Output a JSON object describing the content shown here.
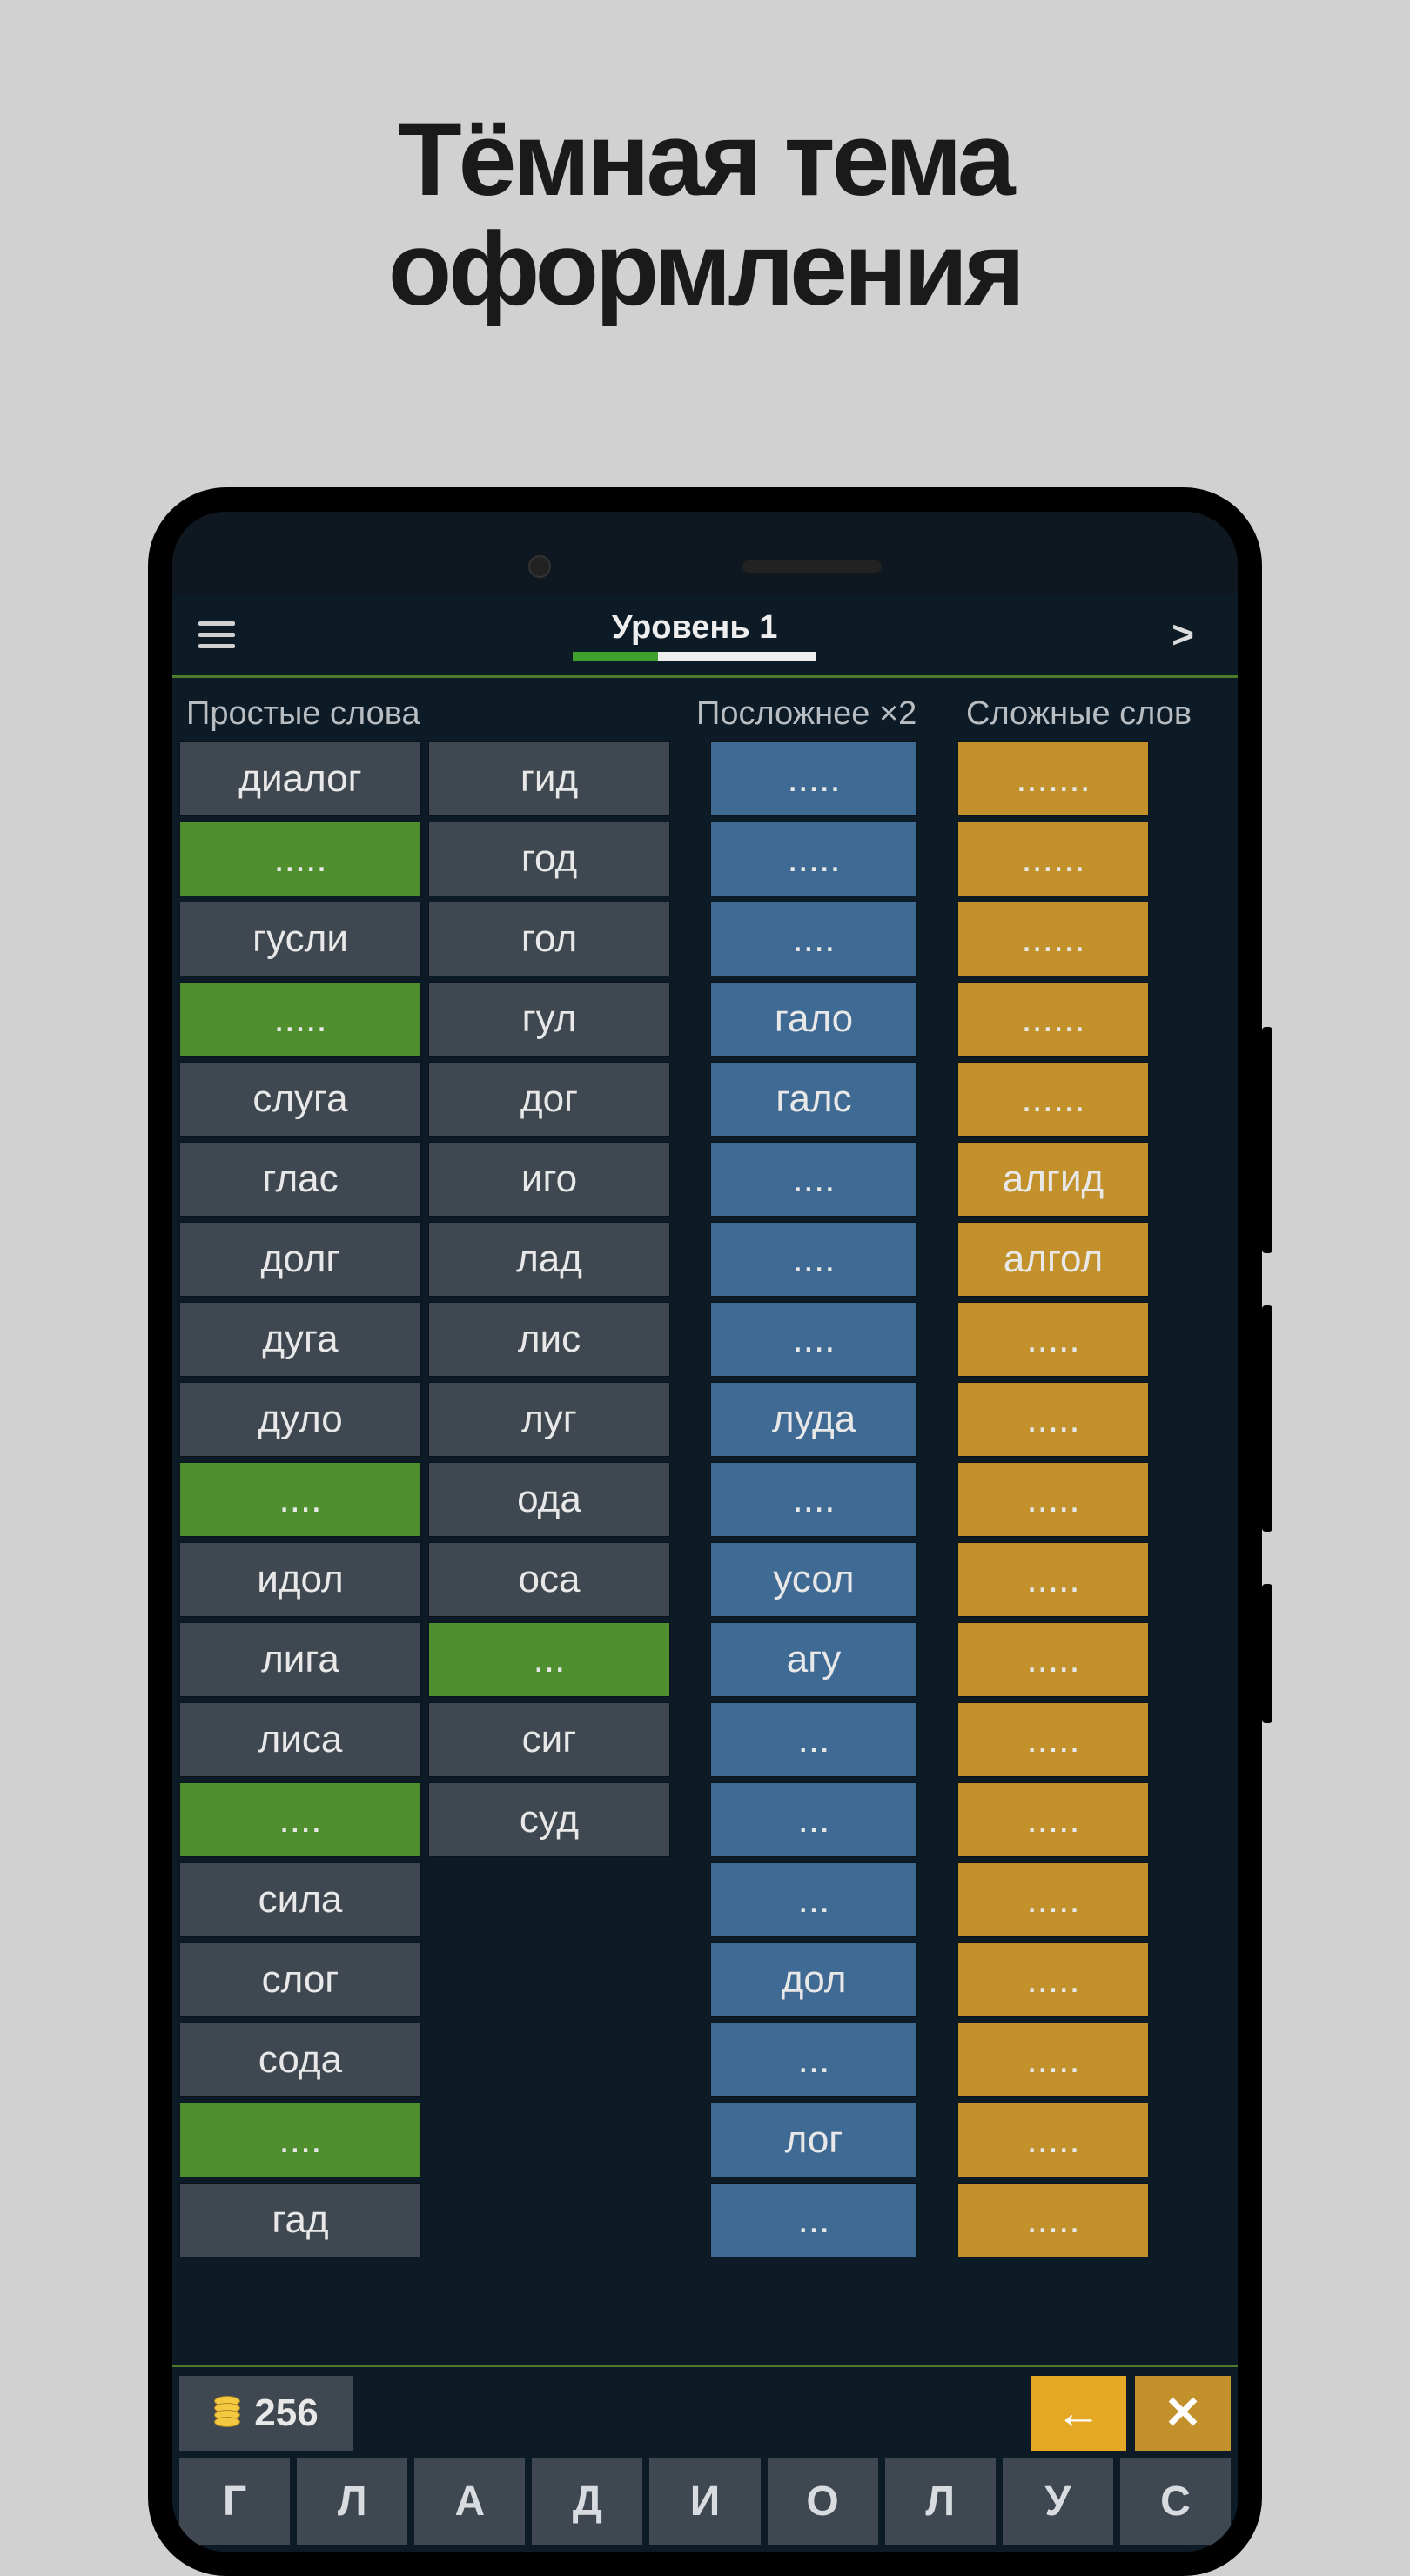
{
  "page_title_line1": "Тёмная тема",
  "page_title_line2": "оформления",
  "topbar": {
    "level_label": "Уровень 1",
    "progress_percent": 35
  },
  "columns": {
    "header_simple": "Простые слова",
    "header_medium": "Посложнее ×2",
    "header_hard": "Сложные слов",
    "left": [
      {
        "text": "диалог",
        "style": "gray"
      },
      {
        "text": ".....",
        "style": "green"
      },
      {
        "text": "гусли",
        "style": "gray"
      },
      {
        "text": ".....",
        "style": "green"
      },
      {
        "text": "слуга",
        "style": "gray"
      },
      {
        "text": "глас",
        "style": "gray"
      },
      {
        "text": "долг",
        "style": "gray"
      },
      {
        "text": "дуга",
        "style": "gray"
      },
      {
        "text": "дуло",
        "style": "gray"
      },
      {
        "text": "....",
        "style": "green"
      },
      {
        "text": "идол",
        "style": "gray"
      },
      {
        "text": "лига",
        "style": "gray"
      },
      {
        "text": "лиса",
        "style": "gray"
      },
      {
        "text": "....",
        "style": "green"
      },
      {
        "text": "сила",
        "style": "gray"
      },
      {
        "text": "слог",
        "style": "gray"
      },
      {
        "text": "сода",
        "style": "gray"
      },
      {
        "text": "....",
        "style": "green"
      },
      {
        "text": "гад",
        "style": "gray"
      }
    ],
    "mid": [
      {
        "text": "гид",
        "style": "gray"
      },
      {
        "text": "год",
        "style": "gray"
      },
      {
        "text": "гол",
        "style": "gray"
      },
      {
        "text": "гул",
        "style": "gray"
      },
      {
        "text": "дог",
        "style": "gray"
      },
      {
        "text": "иго",
        "style": "gray"
      },
      {
        "text": "лад",
        "style": "gray"
      },
      {
        "text": "лис",
        "style": "gray"
      },
      {
        "text": "луг",
        "style": "gray"
      },
      {
        "text": "ода",
        "style": "gray"
      },
      {
        "text": "оса",
        "style": "gray"
      },
      {
        "text": "...",
        "style": "green"
      },
      {
        "text": "сиг",
        "style": "gray"
      },
      {
        "text": "суд",
        "style": "gray"
      }
    ],
    "blue": [
      {
        "text": ".....",
        "style": "blue"
      },
      {
        "text": ".....",
        "style": "blue"
      },
      {
        "text": "....",
        "style": "blue"
      },
      {
        "text": "гало",
        "style": "blue"
      },
      {
        "text": "галс",
        "style": "blue"
      },
      {
        "text": "....",
        "style": "blue"
      },
      {
        "text": "....",
        "style": "blue"
      },
      {
        "text": "....",
        "style": "blue"
      },
      {
        "text": "луда",
        "style": "blue"
      },
      {
        "text": "....",
        "style": "blue"
      },
      {
        "text": "усол",
        "style": "blue"
      },
      {
        "text": "агу",
        "style": "blue"
      },
      {
        "text": "...",
        "style": "blue"
      },
      {
        "text": "...",
        "style": "blue"
      },
      {
        "text": "...",
        "style": "blue"
      },
      {
        "text": "дол",
        "style": "blue"
      },
      {
        "text": "...",
        "style": "blue"
      },
      {
        "text": "лог",
        "style": "blue"
      },
      {
        "text": "...",
        "style": "blue"
      }
    ],
    "orange": [
      {
        "text": ".......",
        "style": "orange"
      },
      {
        "text": "......",
        "style": "orange"
      },
      {
        "text": "......",
        "style": "orange"
      },
      {
        "text": "......",
        "style": "orange"
      },
      {
        "text": "......",
        "style": "orange"
      },
      {
        "text": "алгид",
        "style": "orange"
      },
      {
        "text": "алгол",
        "style": "orange"
      },
      {
        "text": ".....",
        "style": "orange"
      },
      {
        "text": ".....",
        "style": "orange"
      },
      {
        "text": ".....",
        "style": "orange"
      },
      {
        "text": ".....",
        "style": "orange"
      },
      {
        "text": ".....",
        "style": "orange"
      },
      {
        "text": ".....",
        "style": "orange"
      },
      {
        "text": ".....",
        "style": "orange"
      },
      {
        "text": ".....",
        "style": "orange"
      },
      {
        "text": ".....",
        "style": "orange"
      },
      {
        "text": ".....",
        "style": "orange"
      },
      {
        "text": ".....",
        "style": "orange"
      },
      {
        "text": ".....",
        "style": "orange"
      }
    ]
  },
  "bottom": {
    "coins": "256",
    "back_symbol": "←",
    "close_symbol": "✕"
  },
  "keyboard": [
    "Г",
    "Л",
    "А",
    "Д",
    "И",
    "О",
    "Л",
    "У",
    "С"
  ]
}
